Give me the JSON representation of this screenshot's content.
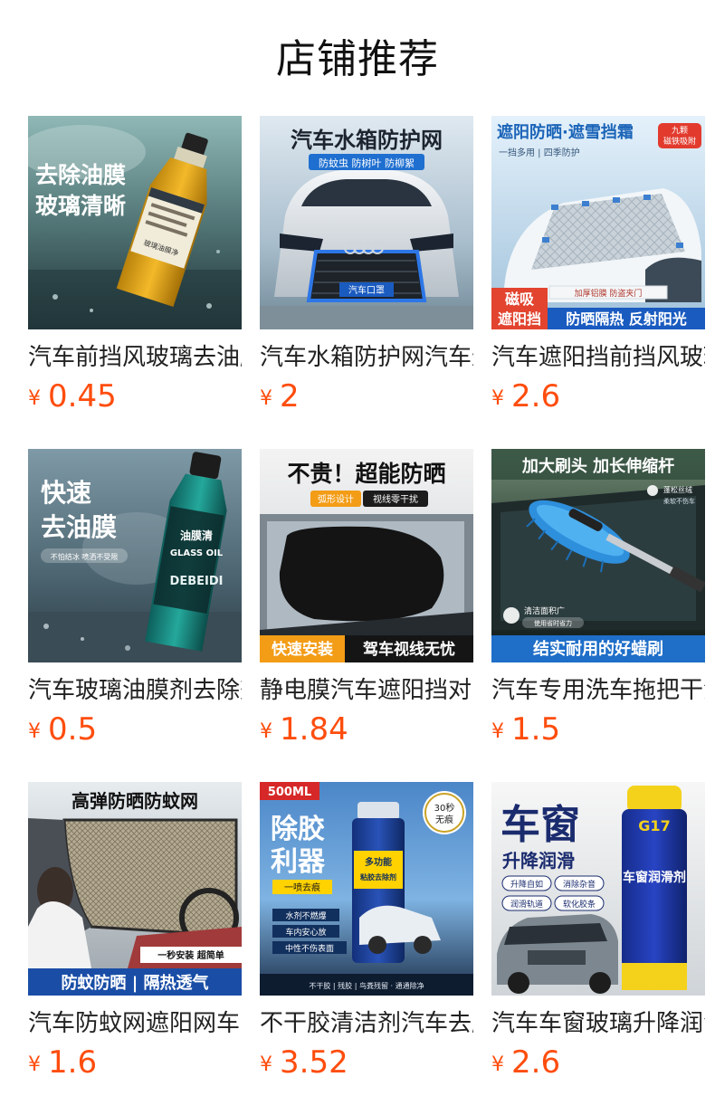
{
  "page": {
    "title": "店铺推荐"
  },
  "colors": {
    "price": "#ff4d0d",
    "title": "#111111",
    "text": "#222222",
    "background": "#ffffff"
  },
  "products": [
    {
      "title": "汽车前挡风玻璃去油膜",
      "currency": "¥",
      "price": "0.45",
      "image": {
        "icon": "glass-oil-remover-bottle",
        "lines": [
          "去除油膜",
          "玻璃清晰"
        ],
        "label": "玻璃油膜净"
      }
    },
    {
      "title": "汽车水箱防护网汽车进气",
      "currency": "¥",
      "price": "2",
      "image": {
        "icon": "car-front-grille",
        "headline": "汽车水箱防护网",
        "tags": "防蚊虫 防树叶 防柳絮",
        "plate": "汽车口罩"
      }
    },
    {
      "title": "汽车遮阳挡前挡风玻璃",
      "currency": "¥",
      "price": "2.6",
      "image": {
        "icon": "car-windshield-cover",
        "headline": "遮阳防晒·遮雪挡霜",
        "badge_line1": "九颗",
        "badge_line2": "磁铁吸附",
        "sub": "一挡多用 | 四季防护",
        "feature": "加厚铝膜 防盗夹门",
        "corner": [
          "磁吸",
          "遮阳挡"
        ],
        "footer": "防晒隔热 反射阳光"
      }
    },
    {
      "title": "汽车玻璃油膜剂去除剂",
      "currency": "¥",
      "price": "0.5",
      "image": {
        "icon": "glass-cleaner-bottle",
        "lines": [
          "快速",
          "去油膜"
        ],
        "note": "不怕结冰 喷洒不受限",
        "label_cn": "油膜清",
        "label_en": "GLASS OIL",
        "brand": "DEBEIDI"
      }
    },
    {
      "title": "静电膜汽车遮阳挡对窗",
      "currency": "¥",
      "price": "1.84",
      "image": {
        "icon": "window-static-film",
        "headline": "不贵！超能防晒",
        "tag1": "弧形设计",
        "tag2": "视线零干扰",
        "footer_left": "快速安装",
        "footer_right": "驾车视线无忧"
      }
    },
    {
      "title": "汽车专用洗车拖把干湿",
      "currency": "¥",
      "price": "1.5",
      "image": {
        "icon": "car-wash-mop",
        "headline": "加大刷头 加长伸缩杆",
        "tag1a": "蓬松丝绒",
        "tag1b": "柔软不伤车",
        "tag2a": "清洁面积广",
        "tag2b": "使用省时省力",
        "footer": "结实耐用的好蜡刷"
      }
    },
    {
      "title": "汽车防蚊网遮阳网车窗",
      "currency": "¥",
      "price": "1.6",
      "image": {
        "icon": "mosquito-net-window",
        "headline": "高弹防晒防蚊网",
        "tag": "一秒安装 超简单",
        "footer": "防蚊防晒 | 隔热透气"
      }
    },
    {
      "title": "不干胶清洁剂汽车去胶剂",
      "currency": "¥",
      "price": "3.52",
      "image": {
        "icon": "adhesive-remover-spray",
        "volume": "500ML",
        "lines": [
          "除胶",
          "利器"
        ],
        "sub": "一喷去痕",
        "tags": [
          "水剂不燃爆",
          "车内安心放",
          "中性不伤表面"
        ],
        "badge_line1": "30秒",
        "badge_line2": "无痕",
        "can_label1": "多功能",
        "can_label2": "粘胶去除剂",
        "footer": "不干胶 | 残胶 | 鸟粪残留 · 通通除净"
      }
    },
    {
      "title": "汽车车窗玻璃升降润滑剂",
      "currency": "¥",
      "price": "2.6",
      "image": {
        "icon": "window-lubricant-spray",
        "big": "车窗",
        "sub": "升降润滑",
        "tags": [
          "升降自如",
          "消除杂音",
          "润滑轨道",
          "软化胶条"
        ],
        "can_label": "车窗润滑剂",
        "can_code": "G17"
      }
    }
  ]
}
